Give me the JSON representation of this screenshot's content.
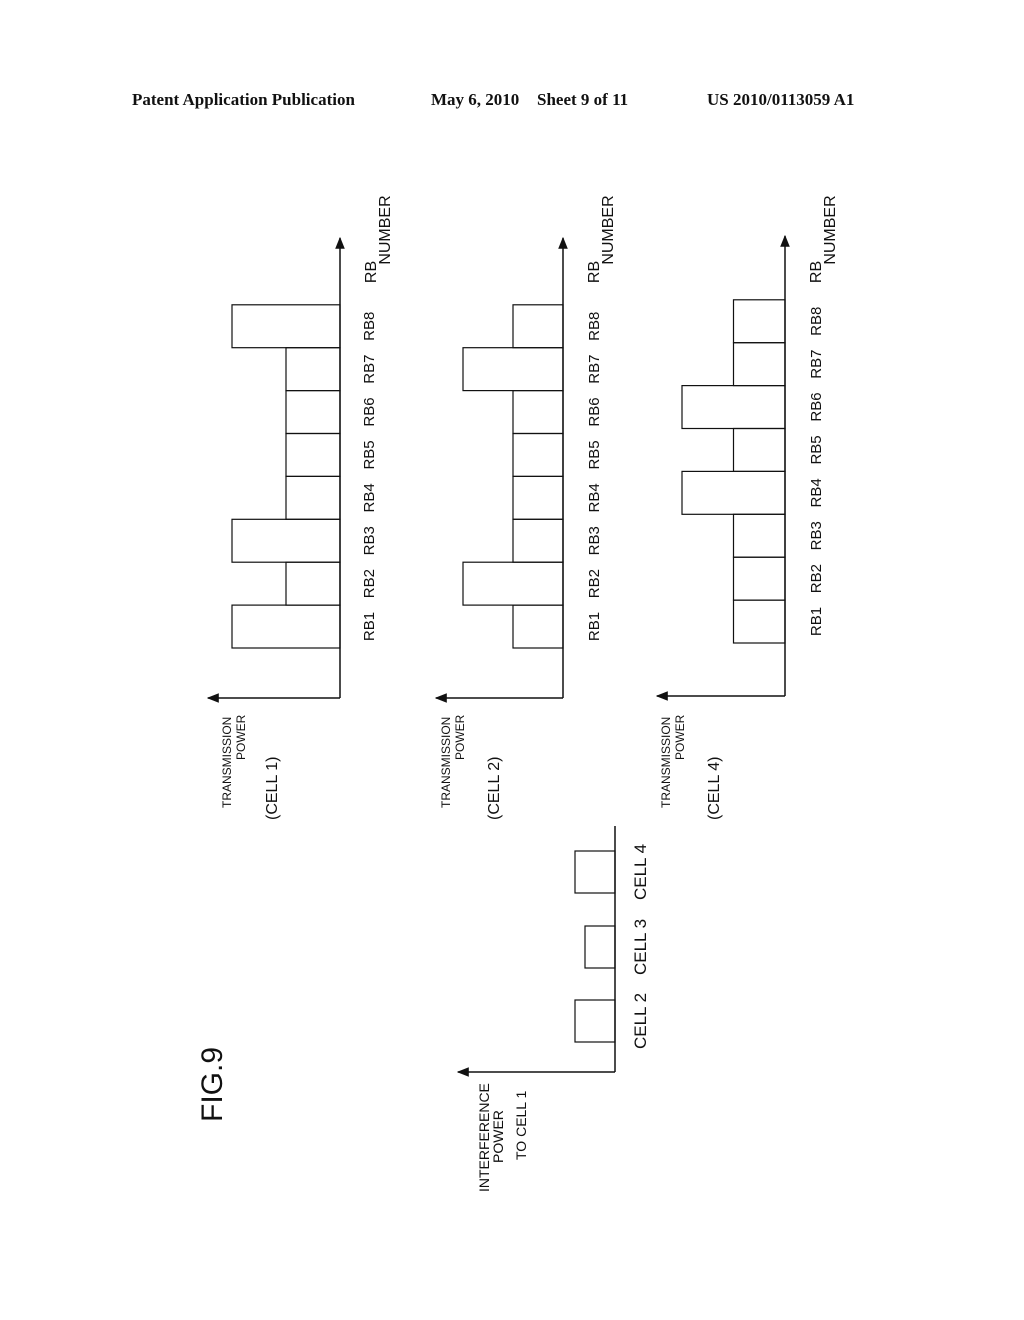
{
  "header": {
    "publication": "Patent Application Publication",
    "date": "May 6, 2010",
    "sheet": "Sheet 9 of 11",
    "number": "US 2010/0113059 A1"
  },
  "figure_label": "FIG.9",
  "chart_data": [
    {
      "type": "bar",
      "title": "(CELL 1)",
      "xlabel": "RB NUMBER",
      "xlabel_lines": [
        "RB",
        "NUMBER"
      ],
      "ylabel": "TRANSMISSION POWER",
      "ylabel_lines": [
        "TRANSMISSION",
        "POWER"
      ],
      "categories": [
        "RB1",
        "RB2",
        "RB3",
        "RB4",
        "RB5",
        "RB6",
        "RB7",
        "RB8"
      ],
      "values": [
        2,
        1,
        2,
        1,
        1,
        1,
        1,
        2
      ],
      "value_scale": "relative (1 = low, 2 = high)",
      "orientation": "page rotated 90° counter-clockwise"
    },
    {
      "type": "bar",
      "title": "(CELL 2)",
      "xlabel": "RB NUMBER",
      "xlabel_lines": [
        "RB",
        "NUMBER"
      ],
      "ylabel": "TRANSMISSION POWER",
      "ylabel_lines": [
        "TRANSMISSION",
        "POWER"
      ],
      "categories": [
        "RB1",
        "RB2",
        "RB3",
        "RB4",
        "RB5",
        "RB6",
        "RB7",
        "RB8"
      ],
      "values": [
        1,
        2,
        1,
        1,
        1,
        1,
        2,
        1
      ],
      "value_scale": "relative (1 = low, 2 = high)",
      "orientation": "page rotated 90° counter-clockwise"
    },
    {
      "type": "bar",
      "title": "(CELL 4)",
      "xlabel": "RB NUMBER",
      "xlabel_lines": [
        "RB",
        "NUMBER"
      ],
      "ylabel": "TRANSMISSION POWER",
      "ylabel_lines": [
        "TRANSMISSION",
        "POWER"
      ],
      "categories": [
        "RB1",
        "RB2",
        "RB3",
        "RB4",
        "RB5",
        "RB6",
        "RB7",
        "RB8"
      ],
      "values": [
        1,
        1,
        1,
        2,
        1,
        2,
        1,
        1
      ],
      "value_scale": "relative (1 = low, 2 = high)",
      "orientation": "page rotated 90° counter-clockwise"
    },
    {
      "type": "bar",
      "title": "",
      "xlabel": "",
      "ylabel": "INTERFERENCE POWER TO CELL 1",
      "ylabel_lines": [
        "INTERFERENCE",
        "POWER",
        "TO CELL 1"
      ],
      "categories": [
        "CELL 2",
        "CELL 3",
        "CELL 4"
      ],
      "values": [
        1.0,
        0.75,
        1.0
      ],
      "value_scale": "relative",
      "orientation": "page rotated 90° counter-clockwise"
    }
  ]
}
